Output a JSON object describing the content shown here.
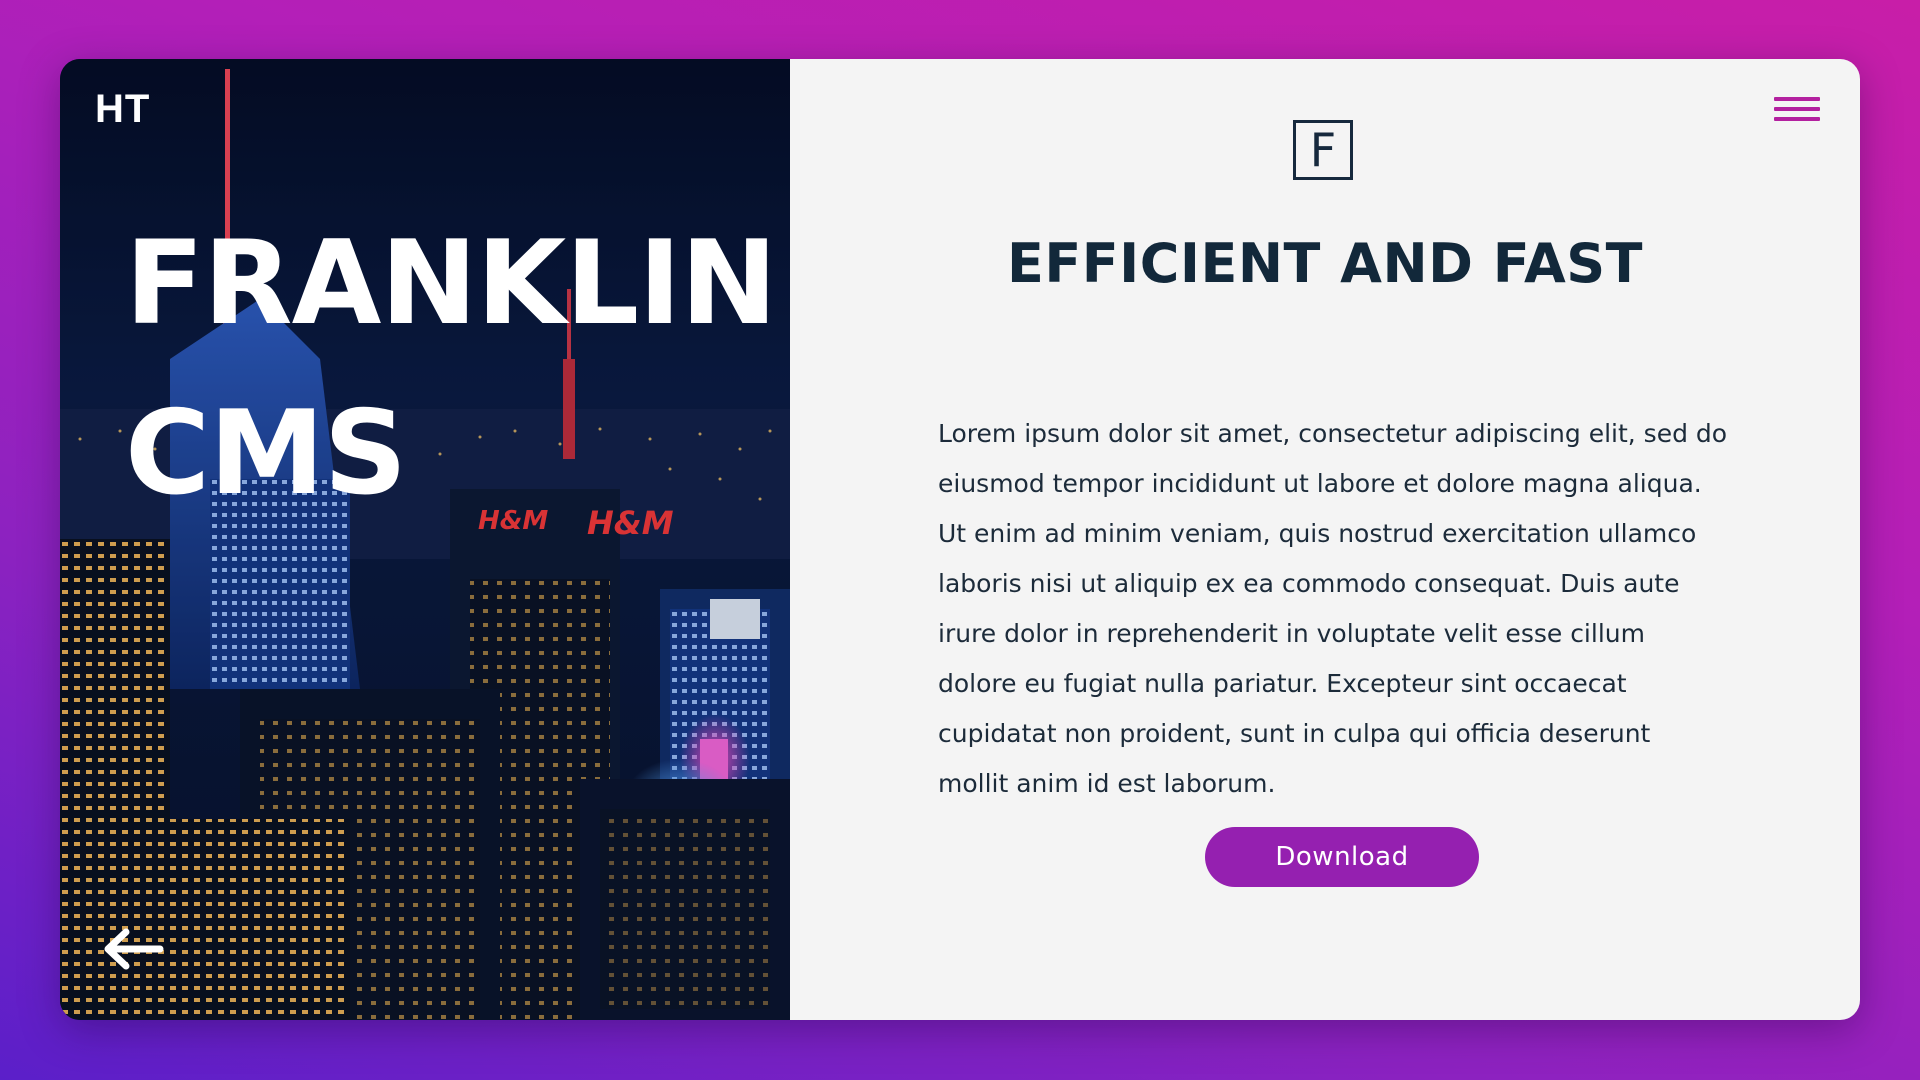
{
  "header": {
    "logo": "HT",
    "title_line1": "FRANKLIN",
    "title_line2": "CMS"
  },
  "content": {
    "brand_icon_letter": "F",
    "heading": "EFFICIENT AND FAST",
    "body": "Lorem ipsum dolor sit amet, consectetur adipiscing elit, sed do eiusmod tempor incididunt ut labore et dolore magna aliqua. Ut enim ad minim veniam, quis nostrud exercitation ullamco laboris nisi ut aliquip ex ea commodo consequat. Duis aute irure dolor in reprehenderit in voluptate velit esse cillum dolore eu fugiat nulla pariatur. Excepteur sint occaecat cupidatat non proident, sunt in culpa qui officia deserunt mollit anim id est laborum.",
    "download_label": "Download"
  },
  "colors": {
    "accent": "#9520b0",
    "menu": "#b3209f",
    "heading": "#12283a",
    "panel": "#f4f4f4"
  },
  "icons": {
    "menu": "hamburger-menu-icon",
    "back": "arrow-left-icon",
    "brand": "letter-f-square-icon"
  }
}
